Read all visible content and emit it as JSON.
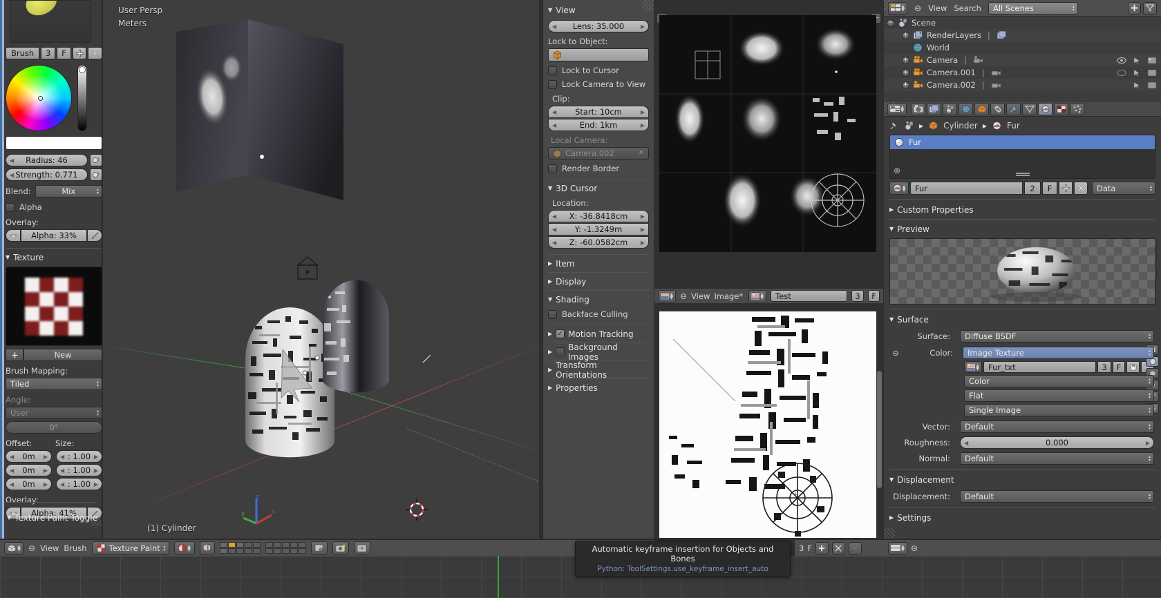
{
  "tool_shelf": {
    "brush_row": {
      "name": "Brush",
      "users": "3",
      "fake": "F",
      "add_icon": "plus-icon",
      "delete_icon": "x-icon"
    },
    "radius": "Radius: 46",
    "strength": "Strength: 0.771",
    "blend_label": "Blend:",
    "blend_value": "Mix",
    "alpha_label": "Alpha",
    "overlay_label": "Overlay:",
    "overlay_alpha": "Alpha: 33%",
    "texture_panel": "Texture",
    "new_button": "New",
    "brush_mapping_label": "Brush Mapping:",
    "brush_mapping_value": "Tiled",
    "angle_label": "Angle:",
    "angle_mode": "User",
    "angle_value": "0°",
    "offset_label": "Offset:",
    "size_label": "Size:",
    "offset_values": [
      "0m",
      "0m",
      "0m"
    ],
    "size_values": [
      ": 1.00",
      ": 1.00",
      ": 1.00"
    ],
    "overlay2_label": "Overlay:",
    "overlay2_alpha": "Alpha: 41%",
    "texture_paint_toggle": "Texture Paint Toggle"
  },
  "viewport": {
    "persp_label": "User Persp",
    "unit_label": "Meters",
    "object_label": "(1) Cylinder",
    "axis_x": "x",
    "axis_y": "y",
    "axis_z": "z"
  },
  "n_panel": {
    "view_panel": "View",
    "lens": "Lens: 35.000",
    "lock_to_object_label": "Lock to Object:",
    "lock_to_object_value": "",
    "lock_to_cursor": "Lock to Cursor",
    "lock_camera_to_view": "Lock Camera to View",
    "clip_label": "Clip:",
    "clip_start": "Start: 10cm",
    "clip_end": "End: 1km",
    "local_camera_label": "Local Camera:",
    "local_camera_value": "Camera.002",
    "render_border": "Render Border",
    "cursor_panel": "3D Cursor",
    "location_label": "Location:",
    "cursor_x": "X: -36.8418cm",
    "cursor_y": "Y: -1.3249m",
    "cursor_z": "Z: -60.0582cm",
    "item_panel": "Item",
    "display_panel": "Display",
    "shading_panel": "Shading",
    "backface_culling": "Backface Culling",
    "motion_tracking": "Motion Tracking",
    "background_images": "Background Images",
    "transform_orientations": "Transform Orientations",
    "properties_panel": "Properties"
  },
  "image_editor": {
    "editor_icon": "image-editor-icon",
    "menu_view": "View",
    "menu_image": "Image*",
    "image_datablock_icon": "image-icon",
    "image_name": "Test",
    "users": "3",
    "fake_user": "F"
  },
  "outliner": {
    "display_mode_icon": "outliner-display-mode-icon",
    "menu_view": "View",
    "menu_search": "Search",
    "scope": "All Scenes",
    "rows": [
      {
        "label": "Scene",
        "icon": "scene-icon",
        "indent": 0,
        "expander": "minus"
      },
      {
        "label": "RenderLayers",
        "icon": "renderlayers-icon",
        "indent": 1,
        "expander": "plus"
      },
      {
        "label": "World",
        "icon": "world-icon",
        "indent": 1,
        "expander": "none"
      },
      {
        "label": "Camera",
        "icon": "camera-icon",
        "indent": 1,
        "expander": "plus"
      },
      {
        "label": "Camera.001",
        "icon": "camera-icon",
        "indent": 1,
        "expander": "plus"
      },
      {
        "label": "Camera.002",
        "icon": "camera-icon",
        "indent": 1,
        "expander": "plus"
      }
    ]
  },
  "properties": {
    "tabs": [
      {
        "name": "render-tab",
        "icon": "camera-back-icon",
        "active": false
      },
      {
        "name": "render-layers-tab",
        "icon": "images-icon",
        "active": false
      },
      {
        "name": "scene-tab",
        "icon": "scene-icon",
        "active": false
      },
      {
        "name": "world-tab",
        "icon": "world-icon",
        "active": false
      },
      {
        "name": "object-tab",
        "icon": "cube-icon",
        "active": false
      },
      {
        "name": "constraints-tab",
        "icon": "chain-icon",
        "active": false
      },
      {
        "name": "modifiers-tab",
        "icon": "wrench-icon",
        "active": false
      },
      {
        "name": "data-tab",
        "icon": "mesh-data-icon",
        "active": false
      },
      {
        "name": "material-tab",
        "icon": "material-sphere-icon",
        "active": true
      },
      {
        "name": "texture-tab",
        "icon": "checker-icon",
        "active": false
      },
      {
        "name": "particles-tab",
        "icon": "particles-icon",
        "active": false
      }
    ],
    "breadcrumb": {
      "pin": "pin-icon",
      "scene": "scene-icon",
      "object": "Cylinder",
      "material": "Fur"
    },
    "material_slots": [
      {
        "name": "Fur",
        "selected": true
      }
    ],
    "material_name": "Fur",
    "material_users": "2",
    "material_fake": "F",
    "datablock_type": "Data",
    "custom_properties": "Custom Properties",
    "preview_panel": "Preview",
    "surface_panel": "Surface",
    "surface_label": "Surface:",
    "surface_value": "Diffuse BSDF",
    "color_label": "Color:",
    "color_value": "Image Texture",
    "image_name": "Fur_txt",
    "image_users": "3",
    "image_fake": "F",
    "color_space": "Color",
    "interpolation": "Flat",
    "image_source": "Single Image",
    "vector_label": "Vector:",
    "vector_value": "Default",
    "roughness_label": "Roughness:",
    "roughness_value": "0.000",
    "normal_label": "Normal:",
    "normal_value": "Default",
    "displacement_panel": "Displacement",
    "displacement_label": "Displacement:",
    "displacement_value": "Default",
    "settings_panel": "Settings"
  },
  "footer": {
    "editor_icon": "editor-type-icon",
    "menu_view": "View",
    "menu_brush": "Brush",
    "mode_icon": "texture-paint-icon",
    "mode": "Texture Paint",
    "shading_icon": "shading-mode-icon",
    "snap_icon": "magnet-icon",
    "record_icon": "record-icon",
    "camera_icon": "render-icon",
    "scene_icon": "scene-switch-icon"
  },
  "props_footer": {
    "users": "3",
    "fake": "F",
    "add_icon": "plus-icon",
    "x_icon": "x-icon",
    "brush_icon": "brush-icon"
  },
  "tooltip": {
    "title": "Automatic keyframe insertion for Objects and Bones",
    "python": "Python: ToolSettings.use_keyframe_insert_auto"
  },
  "colors": {
    "accent_blue": "#5b7fc7",
    "panel_bg": "#3d3d3d",
    "header_bg": "#4e4e4e",
    "viewport_bg": "#3e3e3e",
    "edge_highlight": "#4a6fa5"
  }
}
